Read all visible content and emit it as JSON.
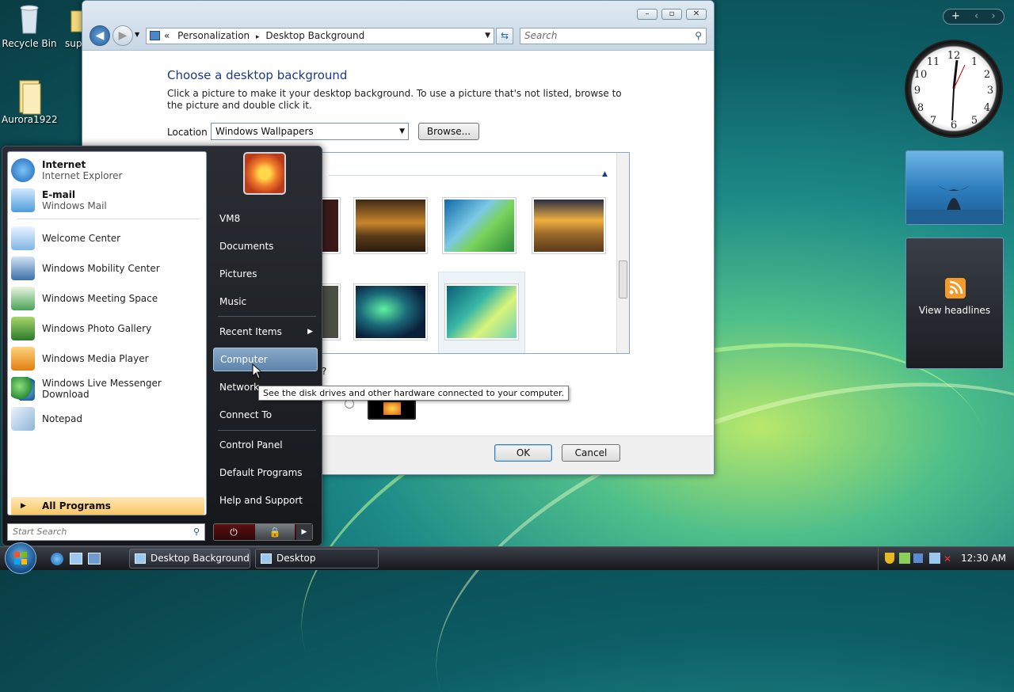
{
  "desktop": {
    "icons": [
      {
        "label": "Recycle Bin"
      },
      {
        "label": "sup"
      },
      {
        "label": "Aurora1922"
      }
    ]
  },
  "window": {
    "address": {
      "prefix": "«",
      "crumb1": "Personalization",
      "sep": "▸",
      "crumb2": "Desktop Background"
    },
    "search_placeholder": "Search",
    "heading": "Choose a desktop background",
    "description": "Click a picture to make it your desktop background. To use a picture that's not listed, browse to the picture and double click it.",
    "location_label": "Location",
    "location_value": "Windows Wallpapers",
    "browse_label": "Browse...",
    "question_fragment": "?",
    "ok_label": "OK",
    "cancel_label": "Cancel",
    "colors": {
      "heading": "#1c3a8a"
    }
  },
  "start_menu": {
    "pinned": [
      {
        "title": "Internet",
        "subtitle": "Internet Explorer"
      },
      {
        "title": "E-mail",
        "subtitle": "Windows Mail"
      }
    ],
    "recent": [
      "Welcome Center",
      "Windows Mobility Center",
      "Windows Meeting Space",
      "Windows Photo Gallery",
      "Windows Media Player",
      "Windows Live Messenger Download",
      "Notepad"
    ],
    "all_programs": "All Programs",
    "search_placeholder": "Start Search",
    "right": [
      "VM8",
      "Documents",
      "Pictures",
      "Music",
      "Recent Items",
      "Computer",
      "Network",
      "Connect To",
      "Control Panel",
      "Default Programs",
      "Help and Support"
    ],
    "tooltip": "See the disk drives and other hardware connected to your computer."
  },
  "sidebar": {
    "feed_label": "View headlines"
  },
  "taskbar": {
    "buttons": [
      "Desktop Background",
      "Desktop"
    ],
    "time": "12:30 AM"
  }
}
